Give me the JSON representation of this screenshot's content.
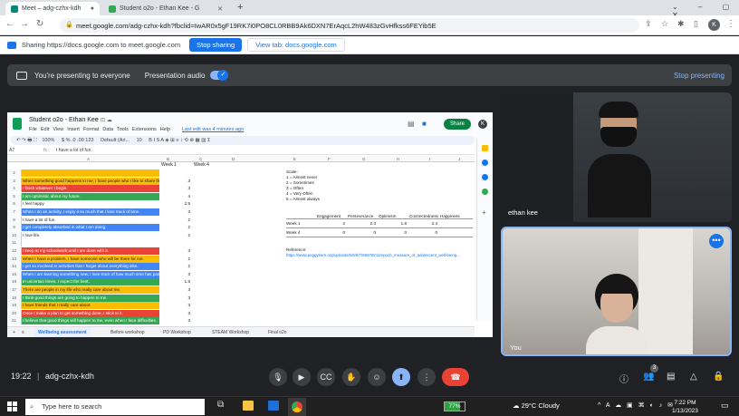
{
  "browser": {
    "tabs": [
      {
        "title": "Meet – adg-czhx-kdh",
        "active": true
      },
      {
        "title": "Student o2o - Ethan Kee - G",
        "active": false
      }
    ],
    "url": "meet.google.com/adg-czhx-kdh?fbclid=IwAR0x5gF19RK7i0PO8CL0RBB9Ak6DXN7ErAqcL2hW483zGvHfkss6FEYib5E"
  },
  "sharing": {
    "text": "Sharing https://docs.google.com to meet.google.com",
    "stop_label": "Stop sharing",
    "view_label": "View tab: docs.google.com"
  },
  "presenting": {
    "text": "You're presenting to everyone",
    "audio_label": "Presentation audio",
    "stop_label": "Stop presenting"
  },
  "sheet": {
    "title": "Student o2o - Ethan Kee",
    "menu": [
      "File",
      "Edit",
      "View",
      "Insert",
      "Format",
      "Data",
      "Tools",
      "Extensions",
      "Help"
    ],
    "last_edit": "Last edit was 4 minutes ago",
    "share_label": "Share",
    "cell_ref": "A7",
    "formula": "I have a lot of fun.",
    "zoom": "100%",
    "font": "Default (Ari...",
    "font_size": "10",
    "col_headers": [
      "A",
      "B",
      "C",
      "D",
      "E",
      "F",
      "G",
      "H",
      "I",
      "J",
      "K"
    ],
    "week_headers": [
      "Week 1",
      "Week 4"
    ],
    "rows": [
      {
        "n": "2",
        "text": "",
        "val": "",
        "color": "#fbbc04"
      },
      {
        "n": "3",
        "text": "When something good happens to me, I have people who I like to share the good news with.",
        "val": "3",
        "color": "#fbbc04"
      },
      {
        "n": "4",
        "text": "I finish whatever I begin.",
        "val": "3",
        "color": "#ea4335"
      },
      {
        "n": "5",
        "text": "I am optimistic about my future.",
        "val": "4",
        "color": "#34a853"
      },
      {
        "n": "6",
        "text": "I feel happy",
        "val": "2.5",
        "color": "#ffffff"
      },
      {
        "n": "7",
        "text": "When I do an activity, I enjoy it so much that I lose track of time.",
        "val": "3",
        "color": "#4285f4"
      },
      {
        "n": "8",
        "text": "I have a lot of fun.",
        "val": "2",
        "color": "#ffffff"
      },
      {
        "n": "9",
        "text": "I get completely absorbed in what I am doing.",
        "val": "2",
        "color": "#4285f4"
      },
      {
        "n": "10",
        "text": "I love life.",
        "val": "2",
        "color": "#ffffff"
      },
      {
        "n": "11",
        "text": "",
        "val": "",
        "color": "#ffffff"
      },
      {
        "n": "12",
        "text": "I keep at my schoolwork until I am done with it.",
        "val": "3",
        "color": "#ea4335"
      },
      {
        "n": "13",
        "text": "When I have a problem, I have someone who will be there for me.",
        "val": "2",
        "color": "#fbbc04"
      },
      {
        "n": "14",
        "text": "I get so involved in activities that I forget about everything else.",
        "val": "2",
        "color": "#4285f4"
      },
      {
        "n": "15",
        "text": "When I am learning something new, I lose track of how much time has passed.",
        "val": "3",
        "color": "#4285f4"
      },
      {
        "n": "16",
        "text": "In uncertain times, I expect the best.",
        "val": "1.5",
        "color": "#34a853"
      },
      {
        "n": "17",
        "text": "There are people in my life who really care about me.",
        "val": "3",
        "color": "#fbbc04"
      },
      {
        "n": "18",
        "text": "I think good things are going to happen to me.",
        "val": "3",
        "color": "#34a853"
      },
      {
        "n": "19",
        "text": "I have friends that I really care about.",
        "val": "3",
        "color": "#fbbc04"
      },
      {
        "n": "20",
        "text": "Once I make a plan to get something done, I stick to it.",
        "val": "3",
        "color": "#ea4335"
      },
      {
        "n": "21",
        "text": "I believe that good things will happen to me, even when I face difficulties.",
        "val": "3",
        "color": "#34a853"
      }
    ],
    "scale": [
      "Scale:",
      "1 = Almost never",
      "2 = Sometimes",
      "3 = Often",
      "4 = Very Often",
      "5 = Almost always"
    ],
    "table_headers": [
      "Engagement",
      "Perseverance",
      "Optimism",
      "Connectedness",
      "Happiness"
    ],
    "table_rows": [
      {
        "label": "Week 1",
        "vals": [
          "2",
          "2.3",
          "1.8",
          "2.4",
          ""
        ]
      },
      {
        "label": "Week 4",
        "vals": [
          "0",
          "0",
          "0",
          "0",
          ""
        ]
      }
    ],
    "reference_label": "Reference:",
    "reference_link": "https://www.peggykern.org/uploads/5/6/6/7/56678211/epoch_measure_of_adolescent_well-being...",
    "sheet_tabs": [
      "Wellbeing assessment",
      "Before workshop",
      "PD Workshop",
      "STEAM Workshop",
      "Final o2o"
    ]
  },
  "participants": [
    {
      "name": "ethan kee"
    },
    {
      "name": "You"
    }
  ],
  "meeting": {
    "time": "19:22",
    "code": "adg-czhx-kdh",
    "people_count": "3"
  },
  "taskbar": {
    "search_placeholder": "Type here to search",
    "battery": "77%",
    "weather": "29°C  Cloudy",
    "time": "7:22 PM",
    "date": "1/13/2023"
  },
  "colors": {
    "accent": "#1a73e8",
    "end_call": "#ea4335",
    "present_on": "#8ab4f8"
  }
}
